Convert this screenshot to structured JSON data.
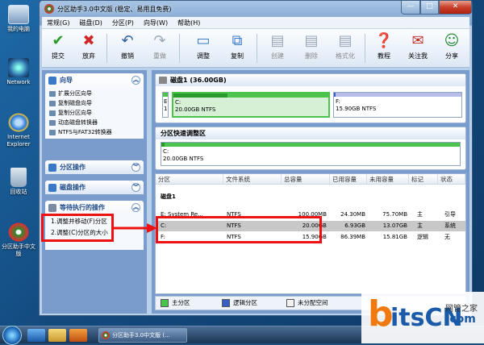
{
  "desktop": {
    "icons": [
      {
        "label": "我的电脑"
      },
      {
        "label": "Network"
      },
      {
        "label": "Internet Explorer"
      },
      {
        "label": "回收站"
      },
      {
        "label": "分区助手中文版"
      }
    ]
  },
  "window": {
    "title": "分区助手3.0中文版 (稳定、易用且免费)",
    "controls": {
      "minimize": "—",
      "maximize": "□",
      "close": "✕"
    }
  },
  "menubar": [
    "常规(G)",
    "磁盘(D)",
    "分区(P)",
    "向导(W)",
    "帮助(H)"
  ],
  "toolbar": [
    {
      "label": "提交",
      "icon": "check-icon",
      "glyph": "✔",
      "color": "#2a9a2a",
      "enabled": true
    },
    {
      "label": "放弃",
      "icon": "discard-icon",
      "glyph": "✖",
      "color": "#d02828",
      "enabled": true
    },
    {
      "label": "撤销",
      "icon": "undo-icon",
      "glyph": "↶",
      "color": "#2f5f9f",
      "enabled": true
    },
    {
      "label": "重做",
      "icon": "redo-icon",
      "glyph": "↷",
      "color": "#9aa8b8",
      "enabled": false
    },
    {
      "label": "调整",
      "icon": "resize-icon",
      "glyph": "▭",
      "color": "#3a7ac8",
      "enabled": true
    },
    {
      "label": "复制",
      "icon": "copy-icon",
      "glyph": "⧉",
      "color": "#3a7ac8",
      "enabled": true
    },
    {
      "label": "创建",
      "icon": "create-icon",
      "glyph": "▤",
      "color": "#9aa8b8",
      "enabled": false
    },
    {
      "label": "删除",
      "icon": "delete-icon",
      "glyph": "▤",
      "color": "#9aa8b8",
      "enabled": false
    },
    {
      "label": "格式化",
      "icon": "format-icon",
      "glyph": "▤",
      "color": "#9aa8b8",
      "enabled": false
    },
    {
      "label": "教程",
      "icon": "tutorial-icon",
      "glyph": "❓",
      "color": "#c03030",
      "enabled": true
    },
    {
      "label": "关注我",
      "icon": "follow-icon",
      "glyph": "✉",
      "color": "#c0302a",
      "enabled": true
    },
    {
      "label": "分享",
      "icon": "share-icon",
      "glyph": "☺",
      "color": "#2a8a3a",
      "enabled": true
    }
  ],
  "left": {
    "wizard": {
      "title": "向导",
      "items": [
        "扩展分区向导",
        "复制磁盘向导",
        "复制分区向导",
        "动态磁盘转换器",
        "NTFS与FAT32转换器"
      ]
    },
    "partition_ops": {
      "title": "分区操作"
    },
    "disk_ops": {
      "title": "磁盘操作"
    },
    "pending": {
      "title": "等待执行的操作",
      "items": [
        "1.调整并移动(F)分区",
        "2.调整(C)分区的大小"
      ]
    }
  },
  "disk_map": {
    "title": "磁盘1 (36.00GB)",
    "small_part": {
      "line1": "E",
      "line2": "1"
    },
    "c_part": {
      "name": "C:",
      "info": "20.00GB NTFS",
      "fill": 0.35
    },
    "f_part": {
      "name": "F:",
      "info": "15.90GB NTFS",
      "fill": 0.01
    }
  },
  "resize_area": {
    "title": "分区快速调整区",
    "name": "C:",
    "info": "20.00GB NTFS",
    "fill": 0.01
  },
  "table": {
    "headers": [
      "分区",
      "文件系统",
      "总容量",
      "已用容量",
      "未用容量",
      "标记",
      "状态"
    ],
    "group": "磁盘1",
    "rows": [
      {
        "part": "E: System Re...",
        "fs": "NTFS",
        "total": "100.00MB",
        "used": "24.30MB",
        "free": "75.70MB",
        "flag": "主",
        "status": "引导",
        "selected": false
      },
      {
        "part": "C:",
        "fs": "NTFS",
        "total": "20.00GB",
        "used": "6.93GB",
        "free": "13.07GB",
        "flag": "主",
        "status": "系统",
        "selected": true
      },
      {
        "part": "F:",
        "fs": "NTFS",
        "total": "15.90GB",
        "used": "86.39MB",
        "free": "15.81GB",
        "flag": "逻辑",
        "status": "无",
        "selected": false
      }
    ]
  },
  "legend": [
    {
      "label": "主分区",
      "color": "#4cc44c"
    },
    {
      "label": "逻辑分区",
      "color": "#3a5ec8"
    },
    {
      "label": "未分配空间",
      "color": "#f4f4f4"
    }
  ],
  "taskbar": {
    "task": "分区助手3.0中文版 (..."
  },
  "watermark": {
    "brand": "itsCN",
    "brand_prefix": "b",
    "tagline": "网管之家",
    "domain": ".com"
  },
  "colors": {
    "primary_green": "#4cc44c",
    "logical_blue": "#3a5ec8",
    "annotation_red": "#ee1111",
    "selected_row": "#c8c8c8"
  }
}
